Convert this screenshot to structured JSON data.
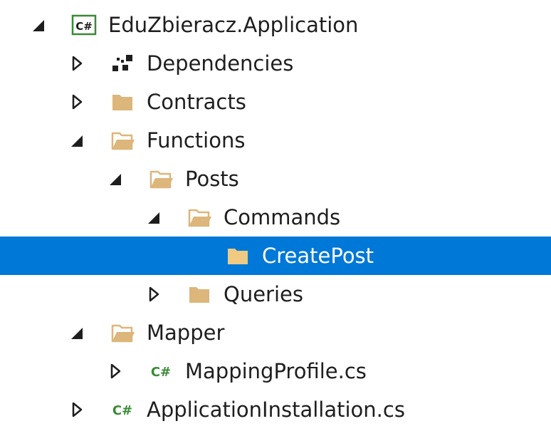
{
  "solution_explorer": {
    "colors": {
      "selection": "#0078d7",
      "folder": "#dcb67a",
      "csharp_green": "#388a34",
      "text": "#1e1e1e",
      "selected_text": "#ffffff"
    },
    "nodes": [
      {
        "label": "EduZbieracz.Application",
        "level": 0,
        "state": "expanded",
        "icon": "csharp-project-icon",
        "icon_text": "C#",
        "selected": false
      },
      {
        "label": "Dependencies",
        "level": 1,
        "state": "collapsed",
        "icon": "dependencies-icon",
        "selected": false
      },
      {
        "label": "Contracts",
        "level": 1,
        "state": "collapsed",
        "icon": "folder-closed-icon",
        "selected": false
      },
      {
        "label": "Functions",
        "level": 1,
        "state": "expanded",
        "icon": "folder-open-icon",
        "selected": false
      },
      {
        "label": "Posts",
        "level": 2,
        "state": "expanded",
        "icon": "folder-open-icon",
        "selected": false
      },
      {
        "label": "Commands",
        "level": 3,
        "state": "expanded",
        "icon": "folder-open-icon",
        "selected": false
      },
      {
        "label": "CreatePost",
        "level": 4,
        "state": "none",
        "icon": "folder-closed-icon",
        "selected": true
      },
      {
        "label": "Queries",
        "level": 3,
        "state": "collapsed",
        "icon": "folder-closed-icon",
        "selected": false
      },
      {
        "label": "Mapper",
        "level": 1,
        "state": "expanded",
        "icon": "folder-open-icon",
        "selected": false
      },
      {
        "label": "MappingProfile.cs",
        "level": 2,
        "state": "collapsed",
        "icon": "csharp-file-icon",
        "icon_text": "C#",
        "selected": false
      },
      {
        "label": "ApplicationInstallation.cs",
        "level": 1,
        "state": "collapsed",
        "icon": "csharp-file-icon",
        "icon_text": "C#",
        "selected": false
      }
    ]
  }
}
